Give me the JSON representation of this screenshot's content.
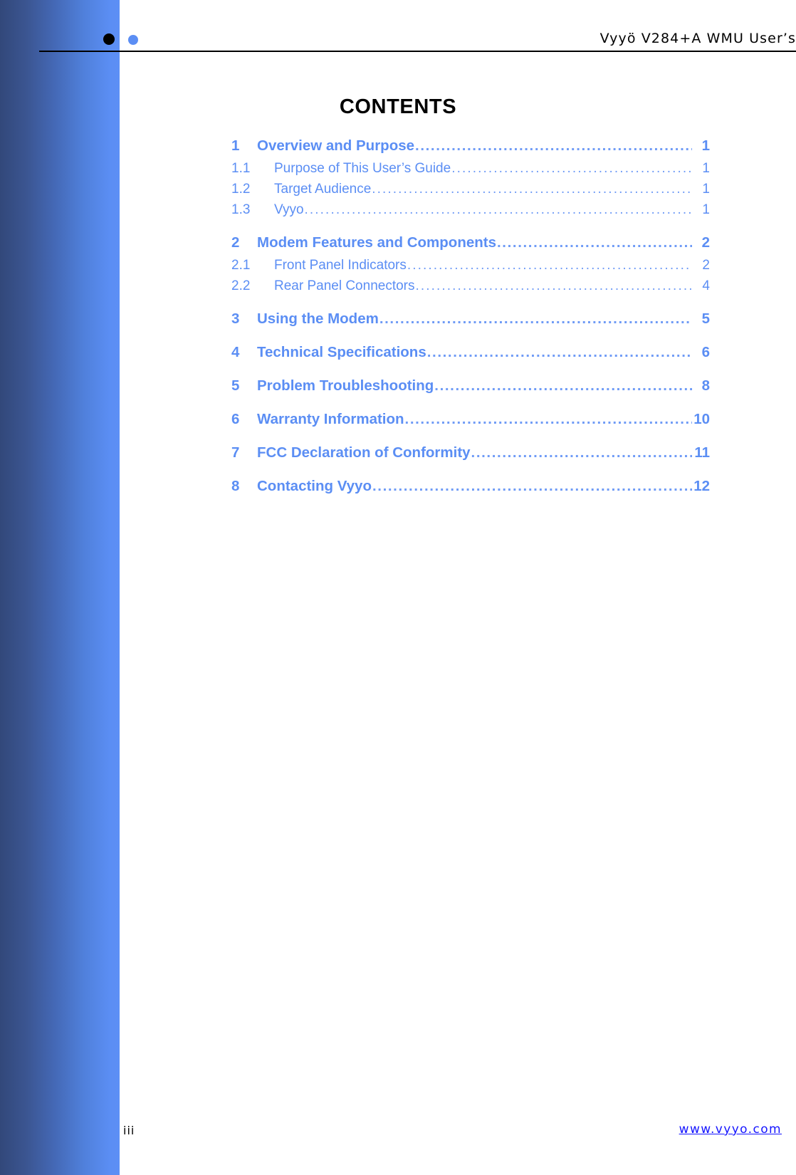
{
  "document": {
    "header_title": "Vyyö V284+A WMU User’s",
    "contents_title": "CONTENTS",
    "page_number": "iii",
    "footer_url": "www.vyyo.com"
  },
  "theme": {
    "accent_blue": "#5b8ef4",
    "gradient_dark": "#32487a",
    "gradient_light": "#5b8ef4",
    "link_blue": "#1414ff",
    "text_black": "#000000"
  },
  "toc": {
    "entries": [
      {
        "level": 1,
        "number": "1",
        "label": "Overview and Purpose",
        "page": "1"
      },
      {
        "level": 2,
        "number": "1.1",
        "label": "Purpose of This User’s Guide",
        "page": "1"
      },
      {
        "level": 2,
        "number": "1.2",
        "label": "Target Audience",
        "page": "1"
      },
      {
        "level": 2,
        "number": "1.3",
        "label": "Vyyo",
        "page": "1"
      },
      {
        "level": 1,
        "number": "2",
        "label": "Modem Features and Components",
        "page": "2"
      },
      {
        "level": 2,
        "number": "2.1",
        "label": "Front Panel Indicators",
        "page": "2"
      },
      {
        "level": 2,
        "number": "2.2",
        "label": "Rear Panel Connectors",
        "page": "4"
      },
      {
        "level": 1,
        "number": "3",
        "label": "Using the Modem",
        "page": "5"
      },
      {
        "level": 1,
        "number": "4",
        "label": "Technical Specifications",
        "page": "6"
      },
      {
        "level": 1,
        "number": "5",
        "label": "Problem Troubleshooting",
        "page": "8"
      },
      {
        "level": 1,
        "number": "6",
        "label": "Warranty Information",
        "page": "10"
      },
      {
        "level": 1,
        "number": "7",
        "label": "FCC Declaration of Conformity",
        "page": "11"
      },
      {
        "level": 1,
        "number": "8",
        "label": "Contacting Vyyo",
        "page": "12"
      }
    ],
    "leader_character": "."
  }
}
